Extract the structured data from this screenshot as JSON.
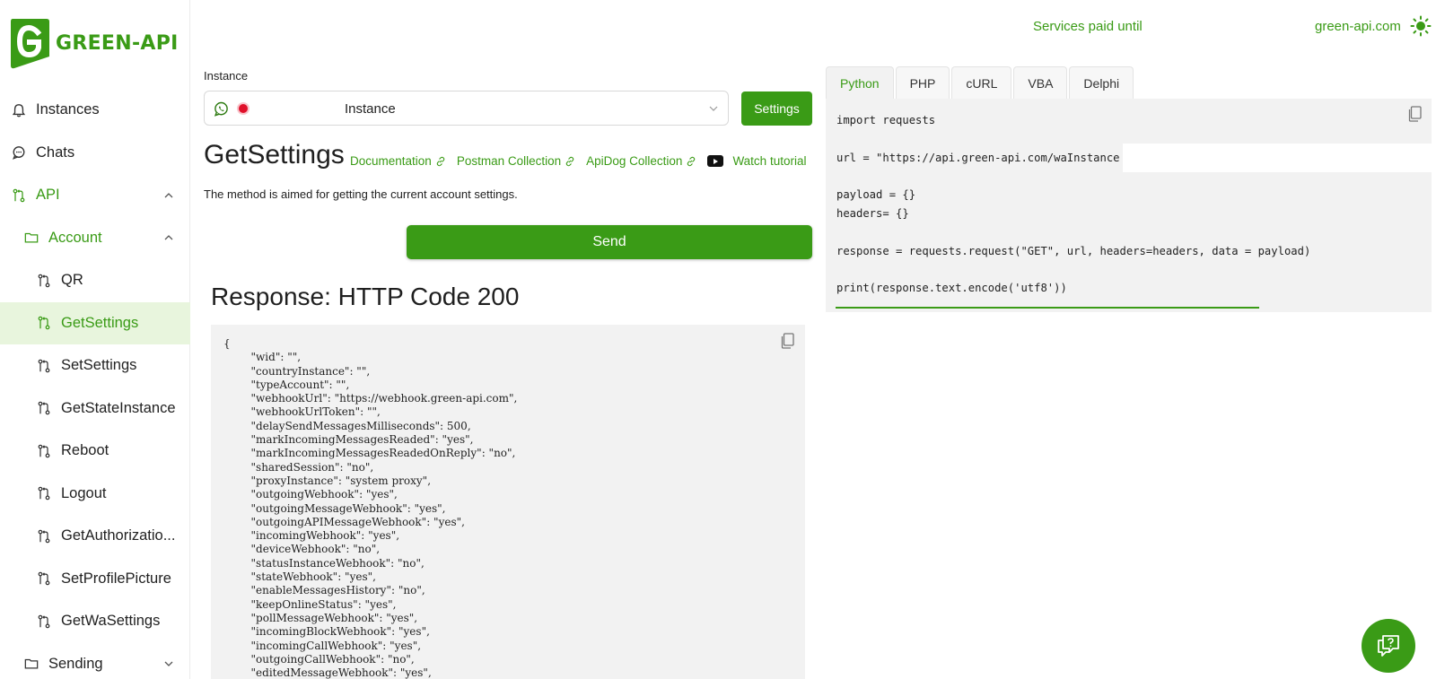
{
  "brand": {
    "name": "GREEN-API"
  },
  "header": {
    "paid_until": "Services paid until",
    "domain": "green-api.com",
    "theme_icon": "sun-icon"
  },
  "sidebar": {
    "items": [
      {
        "label": "Instances",
        "icon": "bell-icon"
      },
      {
        "label": "Chats",
        "icon": "chat-icon"
      },
      {
        "label": "API",
        "icon": "git-icon",
        "expanded": true
      },
      {
        "label": "Account",
        "icon": "folder-icon",
        "expanded": true
      },
      {
        "label": "QR",
        "icon": "git-icon"
      },
      {
        "label": "GetSettings",
        "icon": "git-icon",
        "active": true
      },
      {
        "label": "SetSettings",
        "icon": "git-icon"
      },
      {
        "label": "GetStateInstance",
        "icon": "git-icon"
      },
      {
        "label": "Reboot",
        "icon": "git-icon"
      },
      {
        "label": "Logout",
        "icon": "git-icon"
      },
      {
        "label": "GetAuthorizatio...",
        "icon": "git-icon"
      },
      {
        "label": "SetProfilePicture",
        "icon": "git-icon"
      },
      {
        "label": "GetWaSettings",
        "icon": "git-icon"
      },
      {
        "label": "Sending",
        "icon": "folder-icon",
        "expanded": false
      }
    ]
  },
  "instance": {
    "label": "Instance",
    "value": "Instance",
    "settings_label": "Settings",
    "status_color": "#e0102a"
  },
  "method": {
    "title": "GetSettings",
    "links": [
      "Documentation",
      "Postman Collection",
      "ApiDog Collection"
    ],
    "tutorial": "Watch tutorial",
    "description": "The method is aimed for getting the current account settings."
  },
  "send_label": "Send",
  "response": {
    "title": "Response: HTTP Code 200",
    "body": "{\n        \"wid\": \"\",\n        \"countryInstance\": \"\",\n        \"typeAccount\": \"\",\n        \"webhookUrl\": \"https://webhook.green-api.com\",\n        \"webhookUrlToken\": \"\",\n        \"delaySendMessagesMilliseconds\": 500,\n        \"markIncomingMessagesReaded\": \"yes\",\n        \"markIncomingMessagesReadedOnReply\": \"no\",\n        \"sharedSession\": \"no\",\n        \"proxyInstance\": \"system proxy\",\n        \"outgoingWebhook\": \"yes\",\n        \"outgoingMessageWebhook\": \"yes\",\n        \"outgoingAPIMessageWebhook\": \"yes\",\n        \"incomingWebhook\": \"yes\",\n        \"deviceWebhook\": \"no\",\n        \"statusInstanceWebhook\": \"no\",\n        \"stateWebhook\": \"yes\",\n        \"enableMessagesHistory\": \"no\",\n        \"keepOnlineStatus\": \"yes\",\n        \"pollMessageWebhook\": \"yes\",\n        \"incomingBlockWebhook\": \"yes\",\n        \"incomingCallWebhook\": \"yes\",\n        \"outgoingCallWebhook\": \"no\",\n        \"editedMessageWebhook\": \"yes\","
  },
  "code": {
    "tabs": [
      "Python",
      "PHP",
      "cURL",
      "VBA",
      "Delphi"
    ],
    "active_tab": "Python",
    "snippet": "import requests\n\nurl = \"https://api.green-api.com/waInstance\n\npayload = {}\nheaders= {}\n\nresponse = requests.request(\"GET\", url, headers=headers, data = payload)\n\nprint(response.text.encode('utf8'))"
  },
  "colors": {
    "accent": "#3a9b16",
    "active_bg": "#e8f5dd",
    "code_bg": "#f2f2f2",
    "status_red": "#e0102a"
  }
}
